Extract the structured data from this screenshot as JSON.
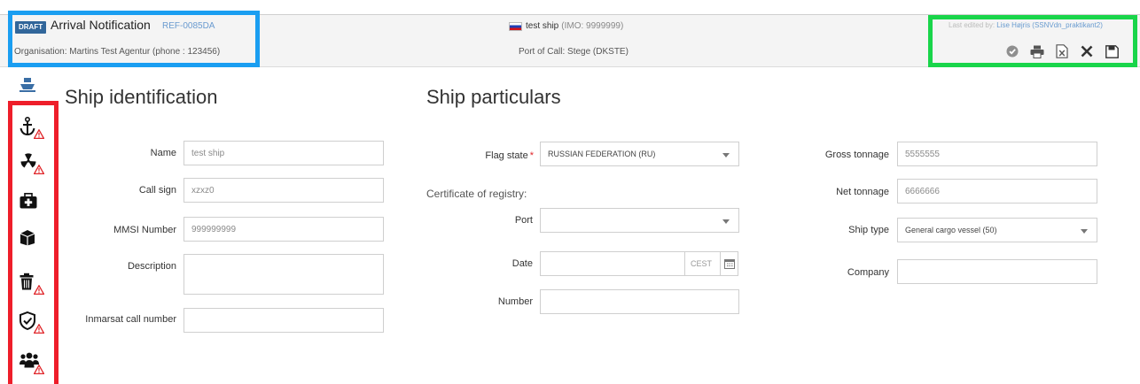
{
  "header": {
    "badge": "DRAFT",
    "title": "Arrival Notification",
    "reference": "REF-0085DA",
    "organisation": "Organisation: Martins Test Agentur (phone : 123456)",
    "ship_name": "test ship",
    "ship_imo": "(IMO: 9999999)",
    "port_of_call": "Port of Call: Stege (DKSTE)",
    "edited_prefix": "Last edited by:",
    "edited_name": "Lise Højris (SSNVdn_praktikant2)"
  },
  "toolbar": {
    "icons": [
      "check-circle-icon",
      "print-icon",
      "excel-export-icon",
      "close-icon",
      "save-icon"
    ]
  },
  "sidebar": {
    "items": [
      "ship-icon",
      "anchor-icon",
      "radiation-icon",
      "medical-kit-icon",
      "ship-stores-icon",
      "waste-icon",
      "security-shield-icon",
      "crew-icon"
    ]
  },
  "ship_identification": {
    "title": "Ship identification",
    "name_label": "Name",
    "name_value": "test ship",
    "callsign_label": "Call sign",
    "callsign_value": "xzxz0",
    "mmsi_label": "MMSI Number",
    "mmsi_value": "999999999",
    "description_label": "Description",
    "description_value": "",
    "inmarsat_label": "Inmarsat call number",
    "inmarsat_value": ""
  },
  "ship_particulars": {
    "title": "Ship particulars",
    "flag_label": "Flag state",
    "flag_required": "*",
    "flag_value": "RUSSIAN FEDERATION (RU)",
    "certificate_title": "Certificate of registry:",
    "port_label": "Port",
    "port_value": "",
    "date_label": "Date",
    "date_value": "",
    "timezone": "CEST",
    "number_label": "Number",
    "number_value": "",
    "gross_label": "Gross tonnage",
    "gross_value": "5555555",
    "net_label": "Net tonnage",
    "net_value": "6666666",
    "shiptype_label": "Ship type",
    "shiptype_value": "General cargo vessel (50)",
    "company_label": "Company",
    "company_value": ""
  },
  "colors": {
    "highlight_blue": "#1a9ef1",
    "highlight_green": "#19d54a",
    "highlight_red": "#ee1e2a",
    "badge": "#31669a",
    "link": "#6a9bd0",
    "warning": "#e0262a"
  }
}
